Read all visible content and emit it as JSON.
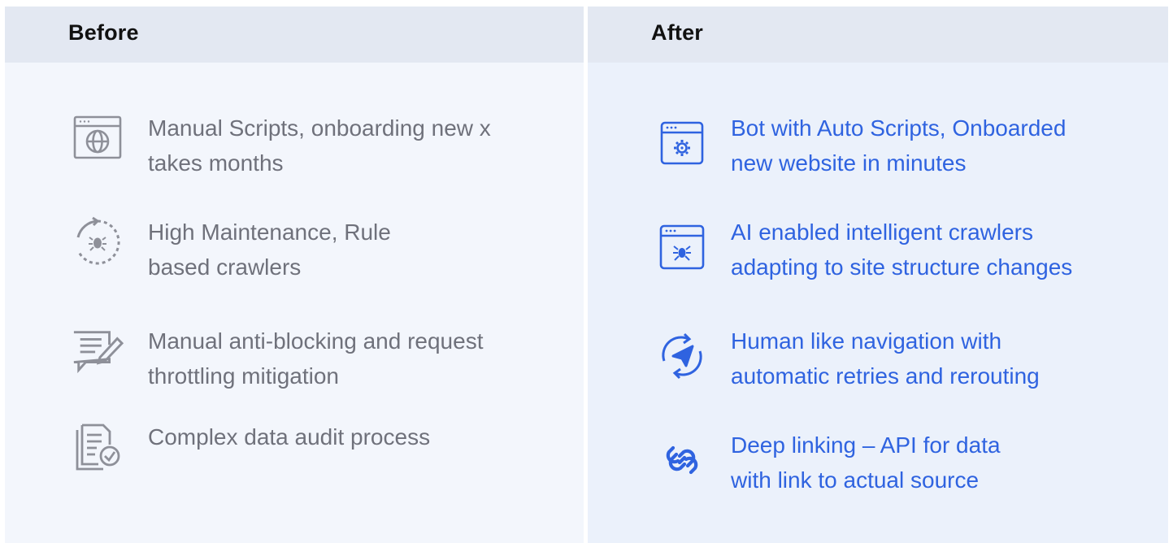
{
  "before": {
    "title": "Before",
    "items": [
      {
        "icon": "browser-globe-icon",
        "text": "Manual Scripts, onboarding new x\ntakes months"
      },
      {
        "icon": "bug-refresh-icon",
        "text": "High Maintenance, Rule\nbased crawlers"
      },
      {
        "icon": "form-edit-icon",
        "text": "Manual anti-blocking and request\nthrottling mitigation"
      },
      {
        "icon": "document-check-icon",
        "text": "Complex data audit process"
      }
    ]
  },
  "after": {
    "title": "After",
    "items": [
      {
        "icon": "browser-gear-icon",
        "text": "Bot with Auto Scripts, Onboarded\nnew website in minutes"
      },
      {
        "icon": "browser-bug-icon",
        "text": "AI enabled intelligent crawlers\nadapting to site structure changes"
      },
      {
        "icon": "navigation-arrows-icon",
        "text": "Human like navigation with\nautomatic retries and rerouting"
      },
      {
        "icon": "chain-link-icon",
        "text": "Deep linking – API for data\nwith link to actual source"
      }
    ]
  },
  "colors": {
    "before_text": "#6f717b",
    "after_text": "#2f63e0",
    "header_bg": "#e3e8f2"
  }
}
